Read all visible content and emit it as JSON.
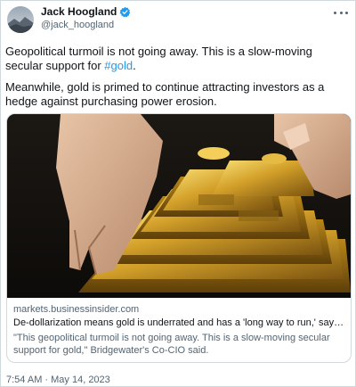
{
  "author": {
    "name": "Jack Hoogland",
    "handle": "@jack_hoogland",
    "verified": true
  },
  "tweet": {
    "text_part1": "Geopolitical turmoil is not going away. This is a slow-moving secular support for ",
    "hashtag": "#gold",
    "text_part1_end": ".",
    "text_part2": "Meanwhile, gold is primed to continue attracting investors as a hedge against purchasing power erosion.",
    "timestamp": "7:54 AM · May 14, 2023"
  },
  "card": {
    "domain": "markets.businessinsider.com",
    "title": "De-dollarization means gold is underrated and has a 'long way to run,' says Br...",
    "description": "\"This geopolitical turmoil is not going away. This is a slow-moving secular support for gold,\" Bridgewater's Co-CIO said."
  },
  "colors": {
    "accent": "#1d9bf0",
    "text": "#0f1419",
    "secondary": "#536471",
    "border": "#cfd9de"
  }
}
